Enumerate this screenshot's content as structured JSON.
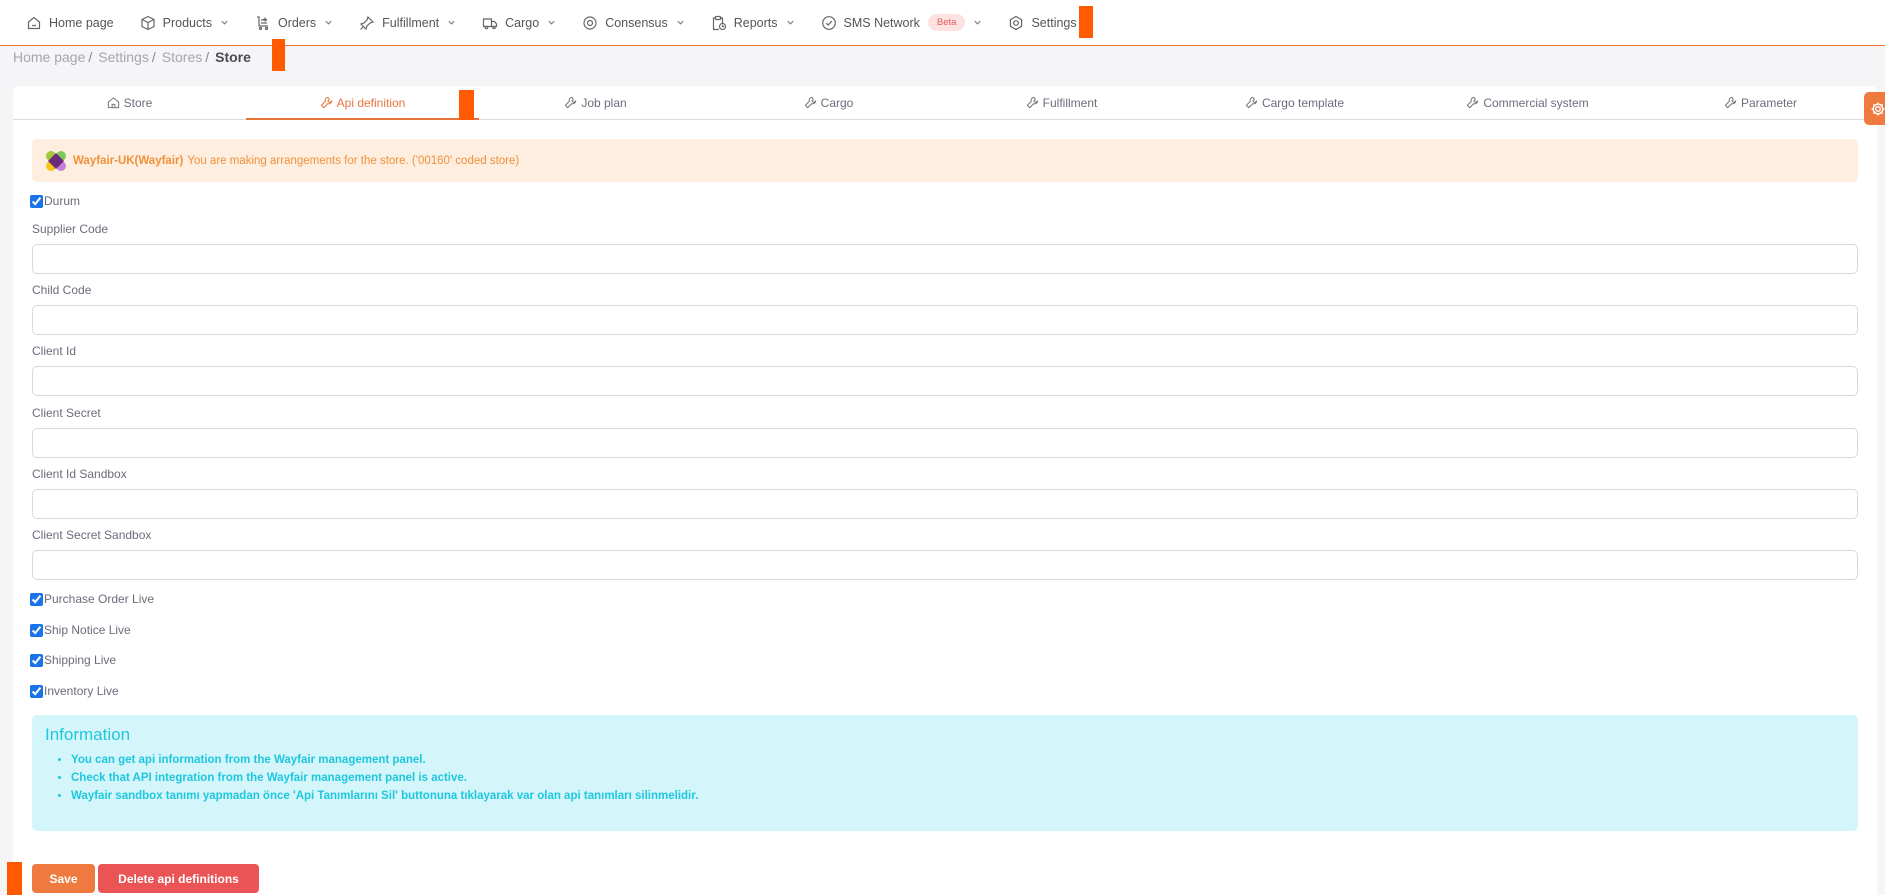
{
  "nav": {
    "items": [
      {
        "label": "Home page",
        "icon": "home-icon",
        "has_dropdown": false
      },
      {
        "label": "Products",
        "icon": "box-icon",
        "has_dropdown": true
      },
      {
        "label": "Orders",
        "icon": "cart-icon",
        "has_dropdown": true
      },
      {
        "label": "Fulfillment",
        "icon": "pin-icon",
        "has_dropdown": true
      },
      {
        "label": "Cargo",
        "icon": "truck-icon",
        "has_dropdown": true
      },
      {
        "label": "Consensus",
        "icon": "target-icon",
        "has_dropdown": true
      },
      {
        "label": "Reports",
        "icon": "clipboard-icon",
        "has_dropdown": true
      },
      {
        "label": "SMS Network",
        "icon": "check-circle-icon",
        "has_dropdown": true,
        "badge": "Beta"
      },
      {
        "label": "Settings",
        "icon": "gear-hex-icon",
        "has_dropdown": false
      }
    ]
  },
  "breadcrumb": {
    "items": [
      "Home page",
      "Settings",
      "Stores"
    ],
    "separator": "/",
    "current": "Store"
  },
  "tabs": [
    {
      "label": "Store",
      "icon": "home-icon",
      "active": false
    },
    {
      "label": "Api definition",
      "icon": "wrench-icon",
      "active": true
    },
    {
      "label": "Job plan",
      "icon": "wrench-icon",
      "active": false
    },
    {
      "label": "Cargo",
      "icon": "wrench-icon",
      "active": false
    },
    {
      "label": "Fulfillment",
      "icon": "wrench-icon",
      "active": false
    },
    {
      "label": "Cargo template",
      "icon": "wrench-icon",
      "active": false
    },
    {
      "label": "Commercial system",
      "icon": "wrench-icon",
      "active": false
    },
    {
      "label": "Parameter",
      "icon": "wrench-icon",
      "active": false
    }
  ],
  "store_alert": {
    "store_name": "Wayfair-UK(Wayfair)",
    "message": "You are making arrangements for the store. ('00160' coded store)"
  },
  "form": {
    "status": {
      "label": "Durum",
      "checked": true
    },
    "fields": [
      {
        "label": "Supplier Code",
        "value": ""
      },
      {
        "label": "Child Code",
        "value": ""
      },
      {
        "label": "Client Id",
        "value": ""
      },
      {
        "label": "Client Secret",
        "value": ""
      },
      {
        "label": "Client Id Sandbox",
        "value": ""
      },
      {
        "label": "Client Secret Sandbox",
        "value": ""
      }
    ],
    "checkboxes": [
      {
        "label": "Purchase Order Live",
        "checked": true
      },
      {
        "label": "Ship Notice Live",
        "checked": true
      },
      {
        "label": "Shipping Live",
        "checked": true
      },
      {
        "label": "Inventory Live",
        "checked": true
      }
    ]
  },
  "info": {
    "title": "Information",
    "items": [
      "You can get api information from the Wayfair management panel.",
      "Check that API integration from the Wayfair management panel is active.",
      "Wayfair sandbox tanımı yapmadan önce 'Api Tanımlarını Sil' buttonuna tıklayarak var olan api tanımları silinmelidir."
    ]
  },
  "actions": {
    "save_label": "Save",
    "delete_label": "Delete api definitions"
  },
  "colors": {
    "accent": "#e8743b",
    "danger": "#ea5455",
    "info": "#1fc7de",
    "warning_bg": "#fdeee0"
  }
}
